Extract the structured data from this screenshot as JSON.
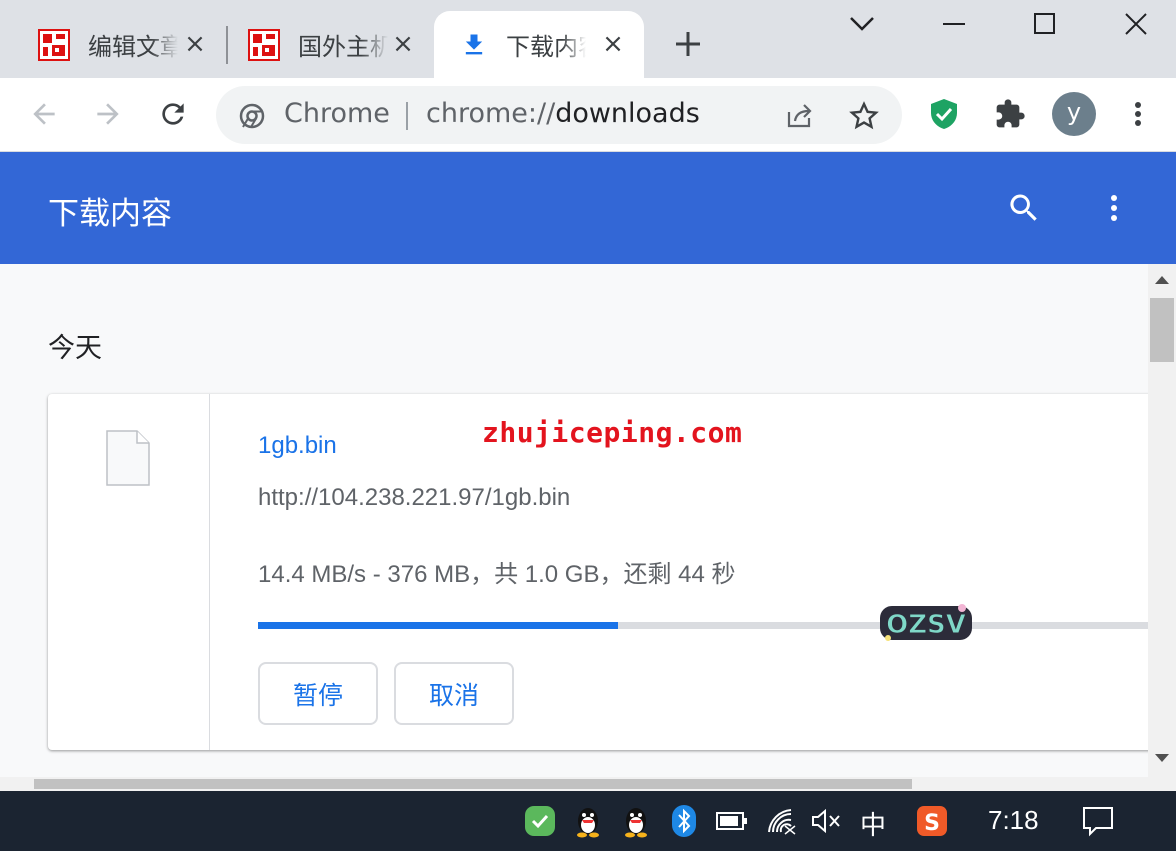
{
  "tabs": [
    {
      "title": "编辑文章",
      "icon": "red-site-favicon-icon",
      "close": "×"
    },
    {
      "title": "国外主机",
      "icon": "red-site-favicon-icon",
      "close": "×"
    },
    {
      "title": "下载内容",
      "icon": "download-icon",
      "close": "×",
      "active": true
    }
  ],
  "toolbar": {
    "omnibox_chip": "Chrome",
    "url_scheme": "chrome://",
    "url_host": "downloads",
    "avatar_letter": "y"
  },
  "page": {
    "title": "下载内容",
    "section_date": "今天"
  },
  "download": {
    "file_name": "1gb.bin",
    "url": "http://104.238.221.97/1gb.bin",
    "status": "14.4 MB/s - 376 MB，共 1.0 GB，还剩 44 秒",
    "progress_percent": 40,
    "pause_label": "暂停",
    "cancel_label": "取消"
  },
  "overlays": {
    "watermark_text": "zhujiceping.com",
    "sticker_text": "OZSV"
  },
  "taskbar": {
    "ime_label": "中",
    "clock": "7:18"
  },
  "colors": {
    "header_blue": "#3367d6",
    "link_blue": "#1a73e8",
    "watermark_red": "#e3141e",
    "taskbar_bg": "#1b2431"
  }
}
